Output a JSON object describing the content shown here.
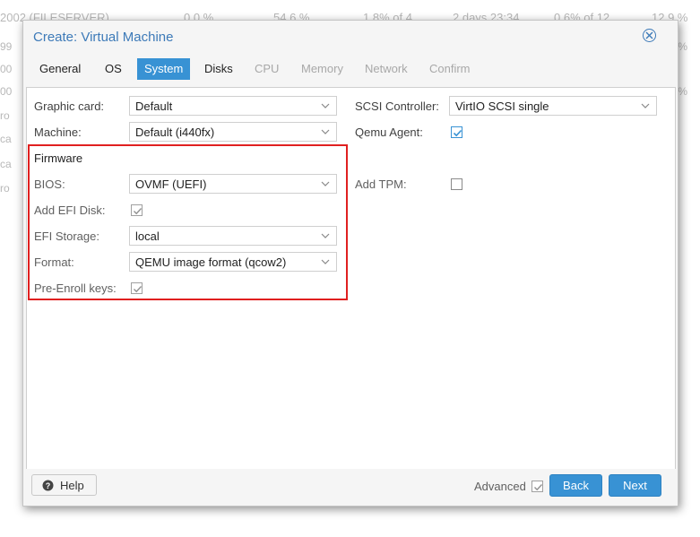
{
  "background": {
    "row": [
      "2002 (FILESERVER)",
      "0.0 %",
      "54.6 %",
      "1.8% of 4",
      "2 days 23:34",
      "0.6% of 12",
      "12.9 %"
    ],
    "side_left": [
      "99",
      "00",
      "00",
      "ro",
      "ca",
      "ca",
      "ro"
    ],
    "side_right": [
      "%",
      "%"
    ]
  },
  "window": {
    "title": "Create: Virtual Machine",
    "tabs": [
      {
        "label": "General",
        "state": "normal"
      },
      {
        "label": "OS",
        "state": "normal"
      },
      {
        "label": "System",
        "state": "active"
      },
      {
        "label": "Disks",
        "state": "normal"
      },
      {
        "label": "CPU",
        "state": "disabled"
      },
      {
        "label": "Memory",
        "state": "disabled"
      },
      {
        "label": "Network",
        "state": "disabled"
      },
      {
        "label": "Confirm",
        "state": "disabled"
      }
    ]
  },
  "form": {
    "graphic_card": {
      "label": "Graphic card:",
      "value": "Default"
    },
    "machine": {
      "label": "Machine:",
      "value": "Default (i440fx)"
    },
    "scsi_controller": {
      "label": "SCSI Controller:",
      "value": "VirtIO SCSI single"
    },
    "qemu_agent": {
      "label": "Qemu Agent:",
      "checked": true
    },
    "firmware": {
      "title": "Firmware",
      "bios": {
        "label": "BIOS:",
        "value": "OVMF (UEFI)"
      },
      "add_efi_disk": {
        "label": "Add EFI Disk:",
        "checked": true
      },
      "efi_storage": {
        "label": "EFI Storage:",
        "value": "local"
      },
      "format": {
        "label": "Format:",
        "value": "QEMU image format (qcow2)"
      },
      "pre_enroll_keys": {
        "label": "Pre-Enroll keys:",
        "checked": true
      }
    },
    "add_tpm": {
      "label": "Add TPM:",
      "checked": false
    }
  },
  "footer": {
    "help_label": "Help",
    "advanced_label": "Advanced",
    "advanced_checked": true,
    "back_label": "Back",
    "next_label": "Next"
  },
  "colors": {
    "accent": "#3892d4",
    "title": "#3d7ab8",
    "highlight": "#e02020"
  }
}
